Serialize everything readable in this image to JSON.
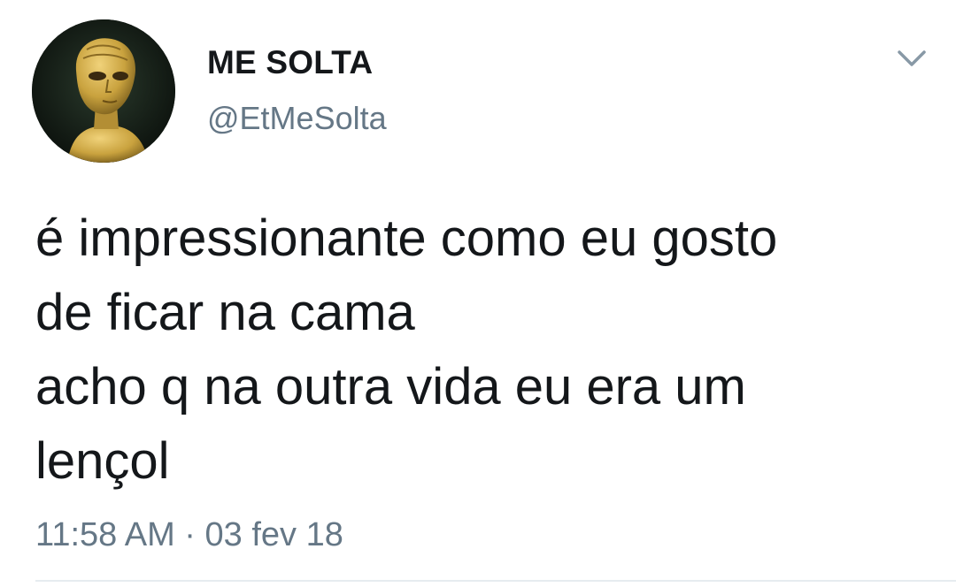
{
  "author": {
    "display_name": "ME SOLTA",
    "handle": "@EtMeSolta",
    "avatar_icon": "alien-avatar"
  },
  "tweet": {
    "lines": [
      "é impressionante como eu gosto",
      "de ficar na cama",
      "acho q na outra vida eu era um",
      "lençol"
    ],
    "timestamp": "11:58 AM · 03 fev 18"
  },
  "menu": {
    "icon": "chevron-down-icon"
  },
  "colors": {
    "text": "#14171a",
    "secondary": "#657786",
    "caret": "#8899a6",
    "background": "#ffffff"
  }
}
